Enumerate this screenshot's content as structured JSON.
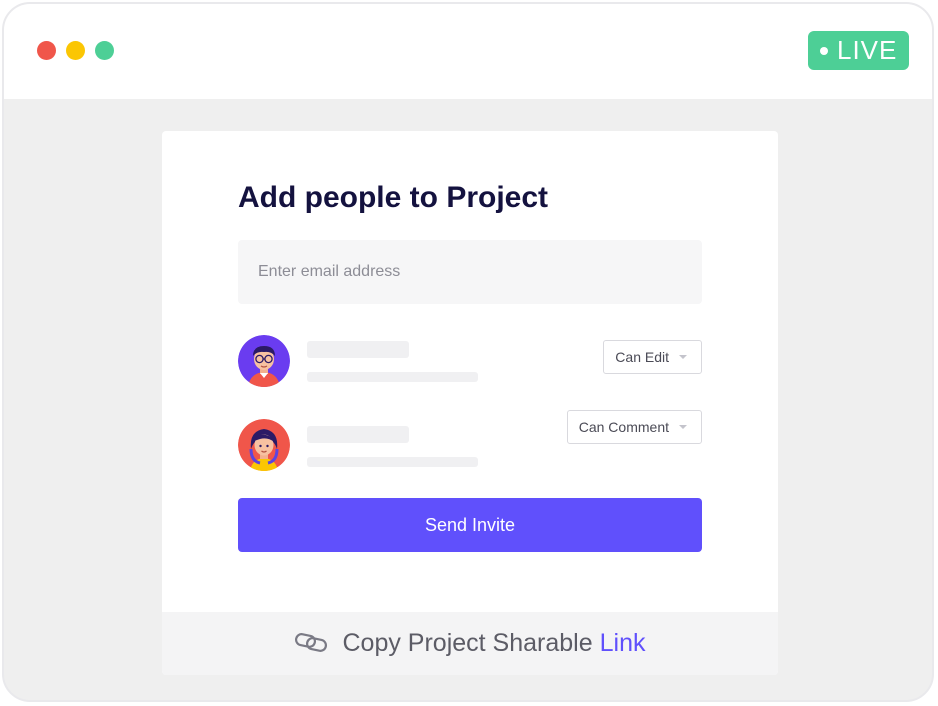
{
  "window": {
    "controls": [
      "close",
      "minimize",
      "maximize"
    ],
    "live_badge": "LIVE",
    "colors": {
      "live": "#4dcf96",
      "close": "#f0564a",
      "minimize": "#fbc603",
      "maximize": "#4dcf96"
    }
  },
  "dialog": {
    "title": "Add people to Project",
    "email_placeholder": "Enter email address",
    "email_value": "",
    "members": [
      {
        "avatar": "man-with-glasses-avatar",
        "role": "Can Edit"
      },
      {
        "avatar": "woman-with-headphones-avatar",
        "role": "Can Comment"
      }
    ],
    "send_label": "Send Invite",
    "accent": "#6050fc"
  },
  "footer": {
    "icon": "link-icon",
    "text": "Copy Project Sharable",
    "link_text": "Link"
  }
}
